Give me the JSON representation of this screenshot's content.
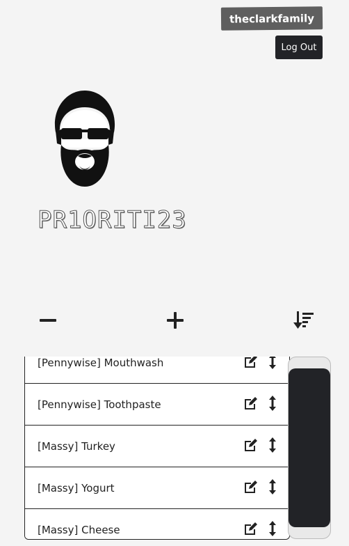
{
  "header": {
    "username": "theclarkfamily",
    "logout_label": "Log Out"
  },
  "app": {
    "title": "PR1ORITI23",
    "avatar_icon": "bearded-man-sunglasses-icon"
  },
  "toolbar": {
    "remove_icon": "minus-icon",
    "add_icon": "plus-icon",
    "sort_icon": "sort-descending-icon"
  },
  "list": {
    "items": [
      {
        "label": "[Pennywise] Mouthwash"
      },
      {
        "label": "[Pennywise] Toothpaste"
      },
      {
        "label": "[Massy] Turkey"
      },
      {
        "label": "[Massy] Yogurt"
      },
      {
        "label": "[Massy] Cheese"
      }
    ],
    "edit_icon": "edit-icon",
    "reorder_icon": "reorder-arrows-icon"
  },
  "colors": {
    "background": "#f4f4f4",
    "badge": "#5f5f5f",
    "dark": "#222327",
    "text": "#222222"
  }
}
